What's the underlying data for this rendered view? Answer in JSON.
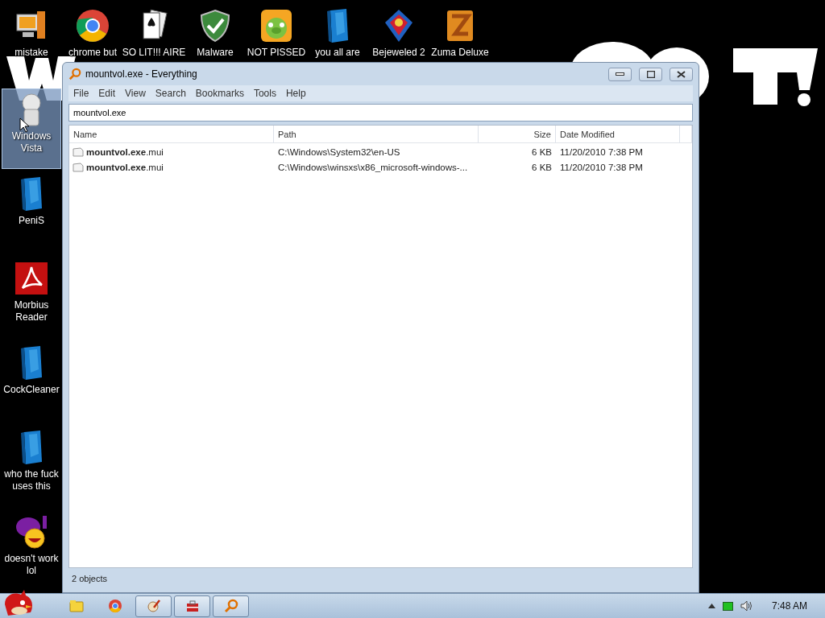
{
  "desktop": {
    "top_icons": [
      {
        "label": "mistake",
        "kind": "computer",
        "selected": false
      },
      {
        "label": "chrome but",
        "kind": "chrome",
        "selected": false
      },
      {
        "label": "SO LIT!!! AIRE",
        "kind": "cards",
        "selected": false
      },
      {
        "label": "Malware",
        "kind": "shield",
        "selected": false
      },
      {
        "label": "NOT PISSED",
        "kind": "pig",
        "selected": false
      },
      {
        "label": "you all are",
        "kind": "book",
        "selected": false
      },
      {
        "label": "Bejeweled 2",
        "kind": "gem",
        "selected": false
      },
      {
        "label": "Zuma Deluxe",
        "kind": "zuma",
        "selected": false
      }
    ],
    "side_icons": [
      {
        "label": "Windows Vista",
        "kind": "ghost",
        "selected": true
      },
      {
        "label": "PeniS",
        "kind": "book",
        "selected": false
      },
      {
        "label": "Morbius Reader",
        "kind": "pdf",
        "selected": false
      },
      {
        "label": "CockCleaner",
        "kind": "book",
        "selected": false
      },
      {
        "label": "who the fuck uses this",
        "kind": "book",
        "selected": false
      },
      {
        "label": "doesn't work lol",
        "kind": "yahoo",
        "selected": false
      }
    ]
  },
  "window": {
    "title": "mountvol.exe - Everything",
    "menu": [
      "File",
      "Edit",
      "View",
      "Search",
      "Bookmarks",
      "Tools",
      "Help"
    ],
    "search": {
      "value": "mountvol.exe"
    },
    "columns": [
      "Name",
      "Path",
      "Size",
      "Date Modified"
    ],
    "rows": [
      {
        "name": "**mountvol.exe**.mui",
        "path": "C:\\Windows\\System32\\en-US",
        "size": "6 KB",
        "date": "11/20/2010 7:38 PM"
      },
      {
        "name": "**mountvol.exe**.mui",
        "path": "C:\\Windows\\winsxs\\x86_microsoft-windows-...",
        "size": "6 KB",
        "date": "11/20/2010 7:38 PM"
      }
    ],
    "status_bar": "2 objects"
  },
  "taskbar": {
    "items": [
      {
        "kind": "folder",
        "active": false
      },
      {
        "kind": "chrome",
        "active": false
      },
      {
        "kind": "paint",
        "active": true
      },
      {
        "kind": "toolbox",
        "active": true
      },
      {
        "kind": "search",
        "active": true
      }
    ],
    "time": "7:48 AM"
  }
}
